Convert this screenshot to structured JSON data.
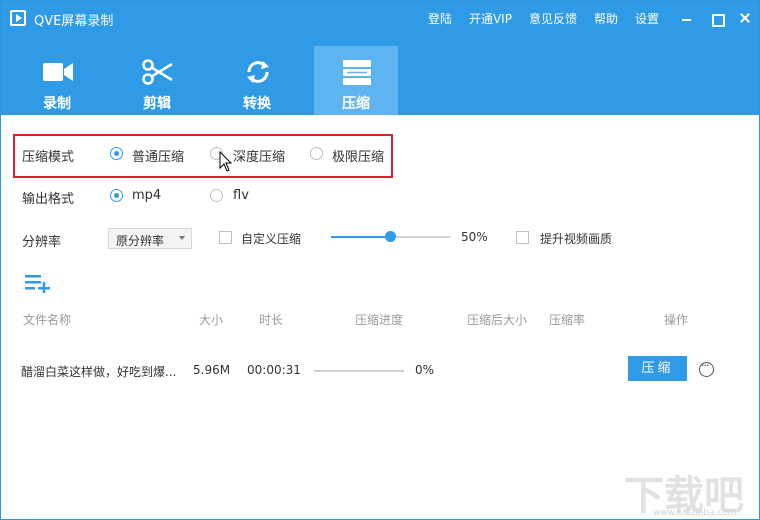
{
  "app": {
    "title": "QVE屏幕录制"
  },
  "top_links": [
    "登陆",
    "开通VIP",
    "意见反馈",
    "帮助",
    "设置"
  ],
  "tabs": [
    {
      "label": "录制",
      "icon": "video-camera-icon"
    },
    {
      "label": "剪辑",
      "icon": "scissors-icon"
    },
    {
      "label": "转换",
      "icon": "refresh-icon"
    },
    {
      "label": "压缩",
      "icon": "compress-icon"
    }
  ],
  "active_tab": "压缩",
  "compress_mode": {
    "label": "压缩模式",
    "options": [
      "普通压缩",
      "深度压缩",
      "极限压缩"
    ],
    "selected": "普通压缩"
  },
  "output_format": {
    "label": "输出格式",
    "options": [
      "mp4",
      "flv"
    ],
    "selected": "mp4"
  },
  "resolution": {
    "label": "分辨率",
    "select_value": "原分辨率",
    "custom_label": "自定义压缩",
    "slider_value": "50%",
    "enhance_label": "提升视频画质"
  },
  "table": {
    "headers": [
      "文件名称",
      "大小",
      "时长",
      "压缩进度",
      "压缩后大小",
      "压缩率",
      "操作"
    ],
    "rows": [
      {
        "name": "醋溜白菜这样做，好吃到爆...",
        "size": "5.96M",
        "duration": "00:00:31",
        "progress": "0%",
        "action": "压缩"
      }
    ]
  },
  "watermark": {
    "text": "下载吧",
    "url": "www.xiazaiba.com"
  },
  "colors": {
    "accent": "#2f9ae6",
    "highlight": "#d9232e"
  }
}
